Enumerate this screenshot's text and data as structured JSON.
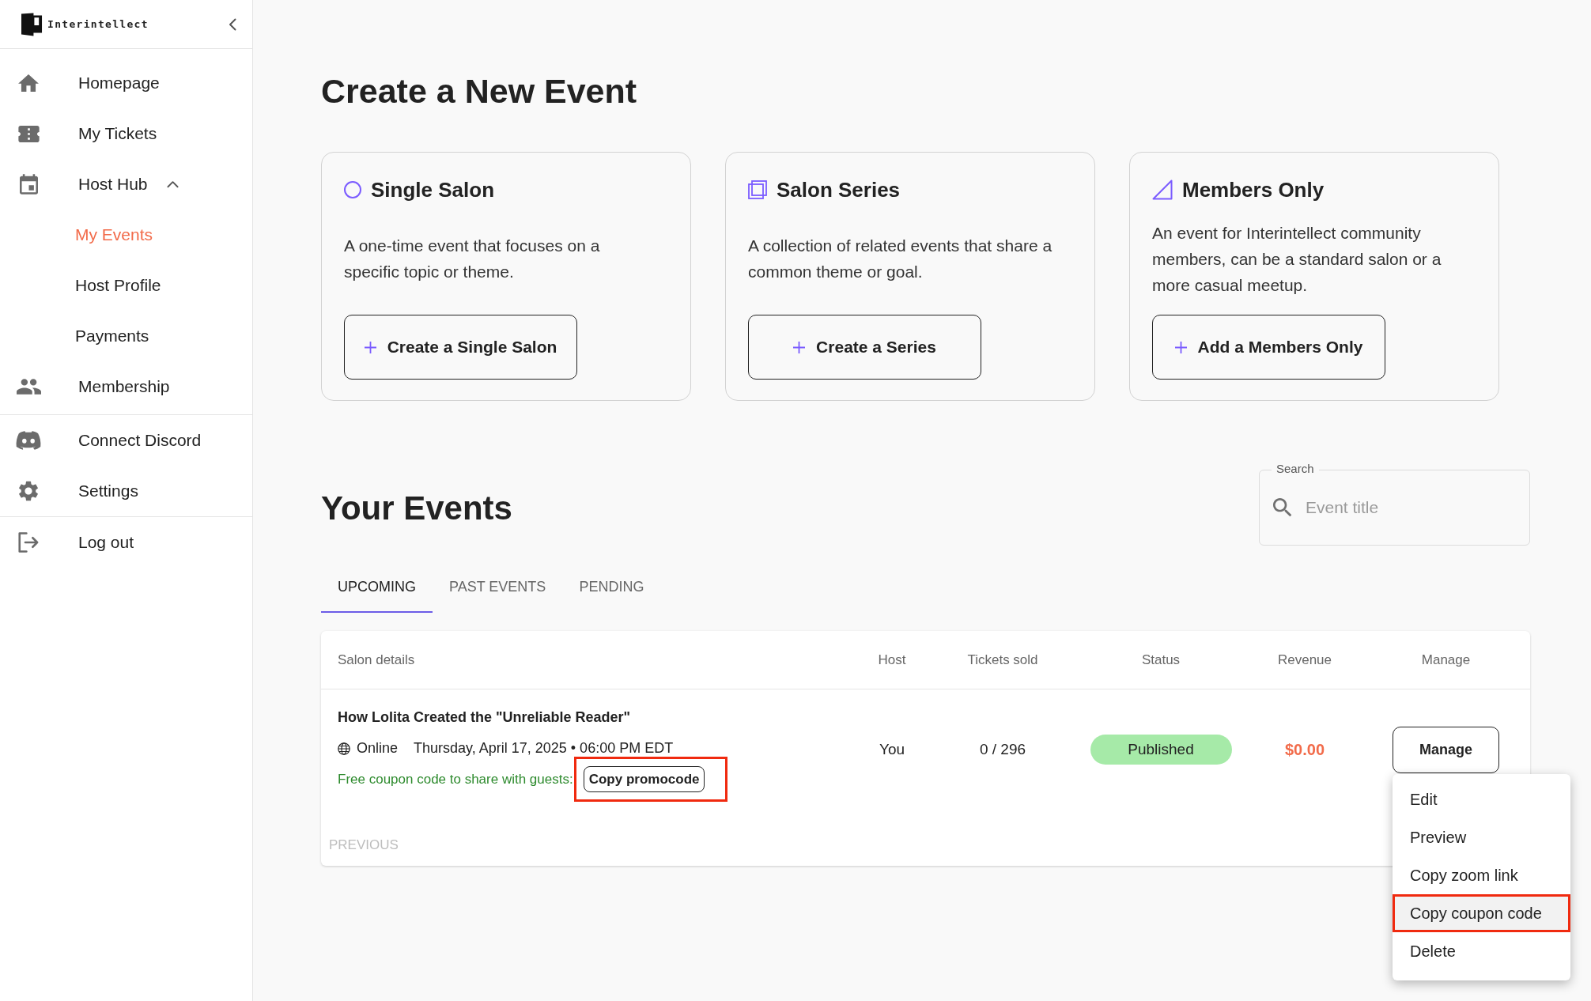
{
  "sidebar": {
    "logo": "Interintellect",
    "sections": [
      {
        "items": [
          {
            "label": "Homepage",
            "selected": false
          },
          {
            "label": "My Tickets",
            "selected": false
          },
          {
            "label": "Host Hub",
            "selected": false,
            "expanded": true,
            "children": [
              {
                "label": "My Events",
                "selected": true
              },
              {
                "label": "Host Profile",
                "selected": false
              },
              {
                "label": "Payments",
                "selected": false
              }
            ]
          },
          {
            "label": "Membership",
            "selected": false
          }
        ]
      },
      {
        "items": [
          {
            "label": "Connect Discord",
            "selected": false
          },
          {
            "label": "Settings",
            "selected": false
          }
        ]
      },
      {
        "items": [
          {
            "label": "Log out",
            "selected": false
          }
        ]
      }
    ]
  },
  "page_title": "Create a New Event",
  "event_types": [
    {
      "title": "Single Salon",
      "description": "A one-time event that focuses on a specific topic or theme.",
      "button": "Create a Single Salon"
    },
    {
      "title": "Salon Series",
      "description": "A collection of related events that share a common theme or goal.",
      "button": "Create a Series"
    },
    {
      "title": "Members Only",
      "description": "An event for Interintellect community members, can be a standard salon or a more casual meetup.",
      "button": "Add a Members Only"
    }
  ],
  "your_events": {
    "title": "Your Events",
    "search": {
      "label": "Search",
      "placeholder": "Event title"
    },
    "tabs": [
      {
        "label": "UPCOMING",
        "selected": true
      },
      {
        "label": "PAST EVENTS",
        "selected": false
      },
      {
        "label": "PENDING",
        "selected": false
      }
    ],
    "table": {
      "columns": [
        "Salon details",
        "Host",
        "Tickets sold",
        "Status",
        "Revenue",
        "Manage"
      ],
      "rows": [
        {
          "title": "How Lolita Created the \"Unreliable Reader\"",
          "location": "Online",
          "date": "Thursday, April 17, 2025 • 06:00 PM EDT",
          "coupon_label": "Free coupon code to share with guests:",
          "coupon_button": {
            "label": "Copy promocode",
            "marked": true
          },
          "host": "You",
          "tickets_sold": "0 / 296",
          "status": "Published",
          "revenue": "$0.00",
          "manage_button": "Manage"
        }
      ]
    },
    "pagination": {
      "previous": "PREVIOUS",
      "disabled": true
    }
  },
  "manage_menu": {
    "items": [
      {
        "label": "Edit",
        "hovered": false,
        "marked": false
      },
      {
        "label": "Preview",
        "hovered": false,
        "marked": false
      },
      {
        "label": "Copy zoom link",
        "hovered": false,
        "marked": false
      },
      {
        "label": "Copy coupon code",
        "hovered": true,
        "marked": true
      },
      {
        "label": "Delete",
        "hovered": false,
        "marked": false
      }
    ]
  }
}
